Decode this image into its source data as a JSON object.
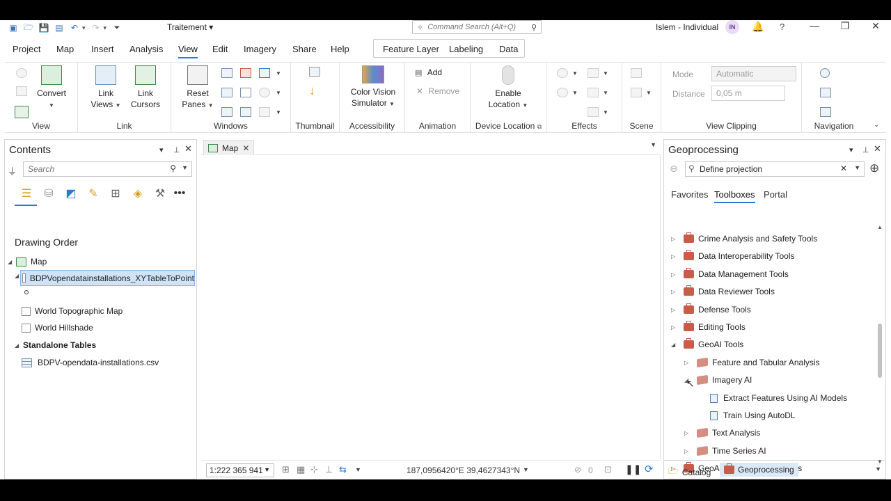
{
  "titlebar": {
    "project_name": "Traitement ▾",
    "command_search_placeholder": "Command Search (Alt+Q)",
    "user_name": "Islem - Individual",
    "avatar_initials": "IN"
  },
  "menu": {
    "tabs": [
      "Project",
      "Map",
      "Insert",
      "Analysis",
      "View",
      "Edit",
      "Imagery",
      "Share",
      "Help"
    ],
    "active_tab": "View",
    "contextual_tabs": [
      "Feature Layer",
      "Labeling",
      "Data"
    ]
  },
  "ribbon": {
    "groups": {
      "view": "View",
      "link": "Link",
      "windows": "Windows",
      "thumbnail": "Thumbnail",
      "accessibility": "Accessibility",
      "animation": "Animation",
      "device_location": "Device Location",
      "effects": "Effects",
      "scene": "Scene",
      "view_clipping": "View Clipping",
      "navigation": "Navigation"
    },
    "buttons": {
      "convert": "Convert",
      "link_views_1": "Link",
      "link_views_2": "Views",
      "link_cursors_1": "Link",
      "link_cursors_2": "Cursors",
      "reset_panes_1": "Reset",
      "reset_panes_2": "Panes",
      "color_vision_1": "Color Vision",
      "color_vision_2": "Simulator",
      "add": "Add",
      "remove": "Remove",
      "enable_location_1": "Enable",
      "enable_location_2": "Location"
    },
    "view_clipping": {
      "mode_label": "Mode",
      "mode_value": "Automatic",
      "distance_label": "Distance",
      "distance_value": "0,05  m"
    }
  },
  "contents": {
    "title": "Contents",
    "search_placeholder": "Search",
    "drawing_order": "Drawing Order",
    "map_label": "Map",
    "layers": [
      {
        "name": "BDPVopendatainstallations_XYTableToPoint",
        "selected": true
      },
      {
        "name": "World Topographic Map",
        "selected": false
      },
      {
        "name": "World Hillshade",
        "selected": false
      }
    ],
    "standalone_tables_header": "Standalone Tables",
    "standalone_table": "BDPV-opendata-installations.csv"
  },
  "map_view": {
    "tab_label": "Map",
    "scale": "1:222 365 941",
    "coordinates": "187,0956420°E 39,4627343°N",
    "selected_count": "0"
  },
  "geoprocessing": {
    "title": "Geoprocessing",
    "search_value": "Define projection",
    "tabs": [
      "Favorites",
      "Toolboxes",
      "Portal"
    ],
    "active_tab": "Toolboxes",
    "items": [
      {
        "label": "Crime Analysis and Safety Tools",
        "kind": "toolbox",
        "level": 0,
        "expanded": false
      },
      {
        "label": "Data Interoperability Tools",
        "kind": "toolbox",
        "level": 0,
        "expanded": false
      },
      {
        "label": "Data Management Tools",
        "kind": "toolbox",
        "level": 0,
        "expanded": false
      },
      {
        "label": "Data Reviewer Tools",
        "kind": "toolbox",
        "level": 0,
        "expanded": false
      },
      {
        "label": "Defense Tools",
        "kind": "toolbox",
        "level": 0,
        "expanded": false
      },
      {
        "label": "Editing Tools",
        "kind": "toolbox",
        "level": 0,
        "expanded": false
      },
      {
        "label": "GeoAI Tools",
        "kind": "toolbox",
        "level": 0,
        "expanded": true
      },
      {
        "label": "Feature and Tabular Analysis",
        "kind": "toolset",
        "level": 1,
        "expanded": false
      },
      {
        "label": "Imagery AI",
        "kind": "toolset",
        "level": 1,
        "expanded": true
      },
      {
        "label": "Extract Features Using AI Models",
        "kind": "tool",
        "level": 2
      },
      {
        "label": "Train Using AutoDL",
        "kind": "tool",
        "level": 2
      },
      {
        "label": "Text Analysis",
        "kind": "toolset",
        "level": 1,
        "expanded": false
      },
      {
        "label": "Time Series AI",
        "kind": "toolset",
        "level": 1,
        "expanded": false
      },
      {
        "label": "GeoAnalytics Desktop Tools",
        "kind": "toolbox",
        "level": 0,
        "expanded": false
      }
    ]
  },
  "bottom_tabs": {
    "catalog": "Catalog",
    "geoprocessing": "Geoprocessing"
  },
  "colors": {
    "accent": "#2a7bd1",
    "toolbox_red": "#c75c4a",
    "selection": "#cfe3f7"
  }
}
